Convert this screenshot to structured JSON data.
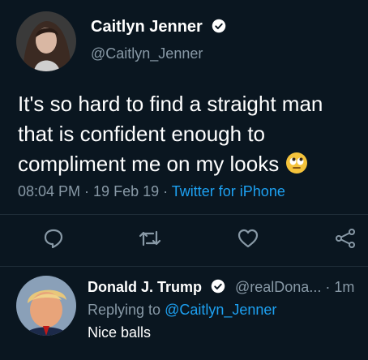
{
  "tweet": {
    "author_name": "Caitlyn Jenner",
    "author_handle": "@Caitlyn_Jenner",
    "text": "It's so hard to find a straight man that is confident enough to compliment me on my looks",
    "emoji": "face-with-rolling-eyes",
    "time": "08:04 PM",
    "separator": " · ",
    "date": "19 Feb 19",
    "source": "Twitter for iPhone",
    "verified": true
  },
  "actions": {
    "reply_icon": "reply-icon",
    "retweet_icon": "retweet-icon",
    "like_icon": "heart-icon",
    "share_icon": "share-icon"
  },
  "reply": {
    "author_name": "Donald J. Trump",
    "author_handle": "@realDona...",
    "age": "1m",
    "replying_prefix": "Replying to ",
    "replying_to": "@Caitlyn_Jenner",
    "text": "Nice balls",
    "verified": true
  },
  "colors": {
    "background": "#0a1620",
    "link": "#1da1f2",
    "muted": "#8899a6"
  }
}
